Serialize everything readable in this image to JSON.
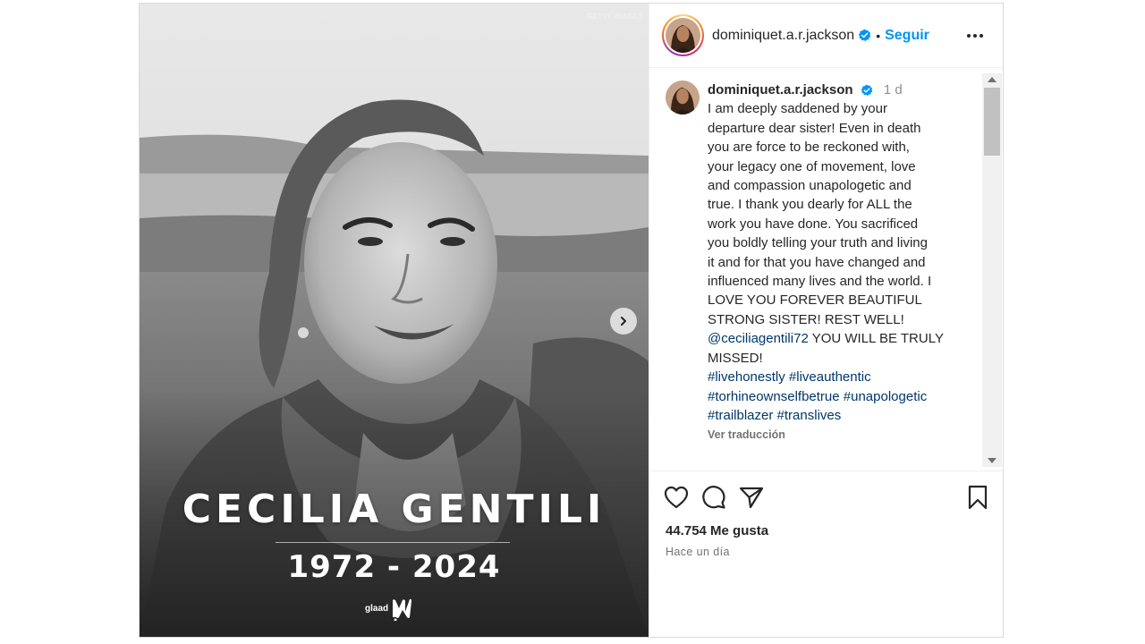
{
  "media": {
    "credit": "GETTY IMAGES",
    "name": "CECILIA GENTILI",
    "years": "1972 - 2024",
    "brand": "glaad"
  },
  "header": {
    "username": "dominiquet.a.r.jackson",
    "separator": "•",
    "follow_label": "Seguir"
  },
  "caption": {
    "username": "dominiquet.a.r.jackson",
    "time": "1 d",
    "lines": [
      "I am deeply saddened by your",
      "departure dear sister! Even in death",
      "you are force to be reckoned with,",
      "your legacy one of movement, love",
      "and compassion unapologetic and",
      "true. I thank you dearly for ALL the",
      "work you have done. You sacrificed",
      "you boldly telling your truth and living",
      "it and for that you have changed and",
      "influenced many lives and the world. I",
      "LOVE YOU FOREVER BEAUTIFUL",
      "STRONG SISTER! REST WELL!"
    ],
    "mention": "@ceciliagentili72",
    "mention_tail": " YOU WILL BE TRULY",
    "last_line": "MISSED!",
    "hashtags": [
      [
        "#livehonestly",
        "#liveauthentic"
      ],
      [
        "#torhineownselfbetrue",
        "#unapologetic"
      ],
      [
        "#trailblazer",
        "#translives"
      ]
    ],
    "translate_label": "Ver traducción"
  },
  "footer": {
    "likes": "44.754 Me gusta",
    "time_ago": "Hace un día"
  },
  "colors": {
    "accent": "#0095f6",
    "link": "#00376b",
    "muted": "#737373",
    "verified": "#0095f6"
  },
  "icons": [
    "verified-badge-icon",
    "more-options-icon",
    "chevron-right-icon",
    "heart-icon",
    "comment-icon",
    "share-icon",
    "bookmark-icon",
    "glaad-logo-icon"
  ]
}
